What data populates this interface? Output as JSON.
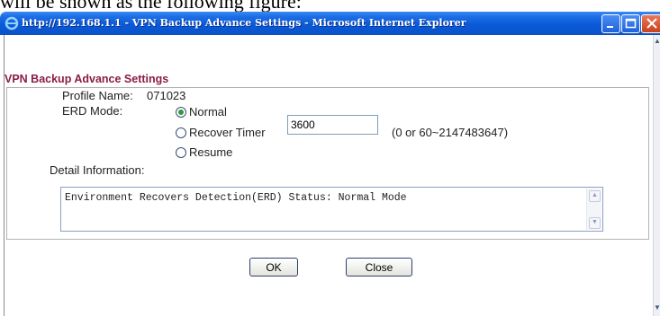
{
  "document": {
    "caption_fragment": "will be shown as the following figure:"
  },
  "window": {
    "title": "http://192.168.1.1 - VPN Backup Advance Settings - Microsoft Internet Explorer",
    "icons": [
      "ie-icon",
      "minimize-icon",
      "maximize-icon",
      "close-icon"
    ]
  },
  "page": {
    "section_title": "VPN Backup Advance Settings",
    "profile_label": "Profile Name:",
    "profile_value": "071023",
    "erd_mode_label": "ERD Mode:",
    "erd_options": [
      {
        "label": "Normal",
        "selected": true
      },
      {
        "label": "Recover Timer",
        "selected": false
      },
      {
        "label": "Resume",
        "selected": false
      }
    ],
    "recover_timer_value": "3600",
    "recover_timer_hint": "(0 or 60~2147483647)",
    "detail_label": "Detail Information:",
    "detail_text": "Environment Recovers Detection(ERD) Status: Normal Mode",
    "ok_label": "OK",
    "close_label": "Close"
  },
  "colors": {
    "section_title": "#8b1c47",
    "titlebar": "#0a5ad8",
    "radio_checked": "#2f9a3a"
  }
}
